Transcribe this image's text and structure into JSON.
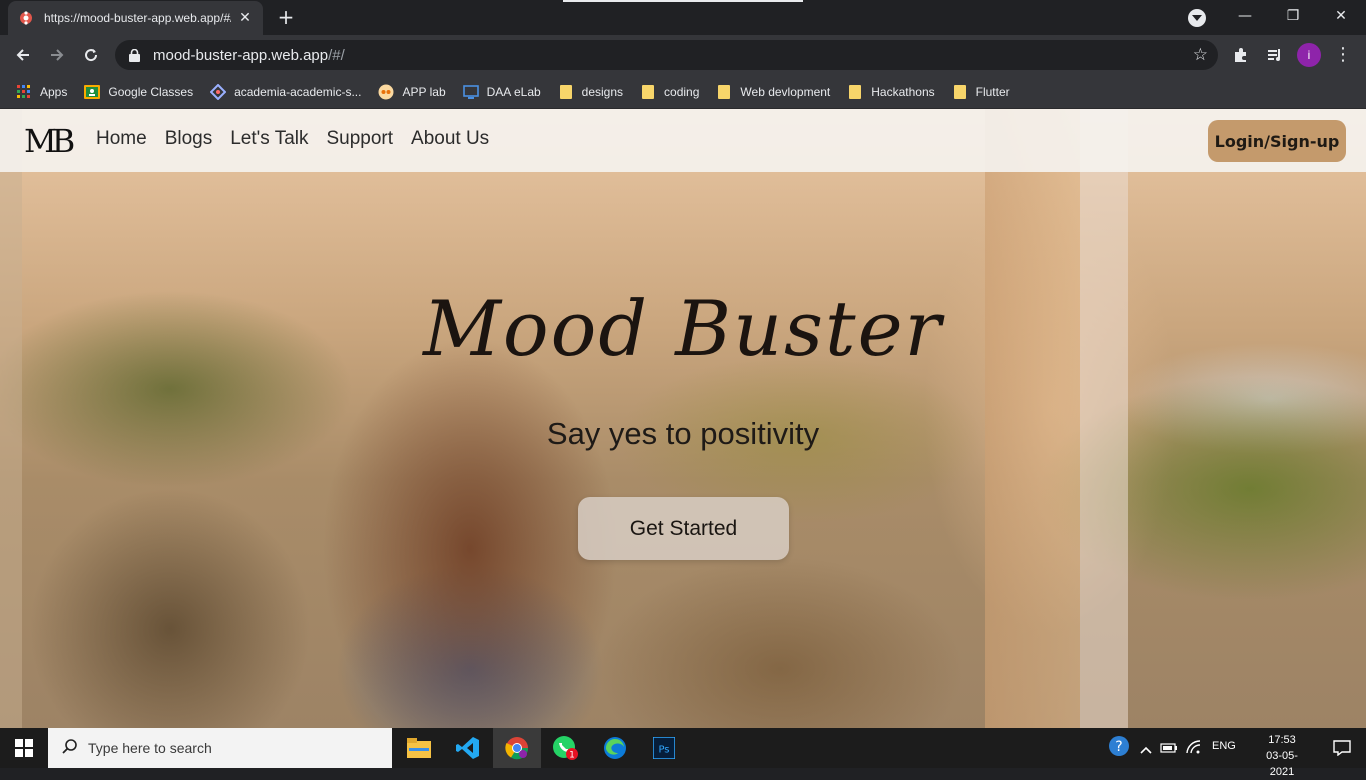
{
  "browser": {
    "tab": {
      "title": "https://mood-buster-app.web.app/#/",
      "favicon": "app-favicon-icon"
    },
    "url_host": "mood-buster-app.web.app",
    "url_path": "/#/",
    "profile_initial": "i",
    "profile_color": "#8e24aa",
    "bookmarks": [
      {
        "label": "Apps",
        "icon": "apps-grid-icon"
      },
      {
        "label": "Google Classes",
        "icon": "classroom-icon"
      },
      {
        "label": "academia-academic-s...",
        "icon": "academia-icon"
      },
      {
        "label": "APP lab",
        "icon": "app-lab-icon"
      },
      {
        "label": "DAA eLab",
        "icon": "elab-icon"
      },
      {
        "label": "designs",
        "icon": "folder-icon"
      },
      {
        "label": "coding",
        "icon": "folder-icon"
      },
      {
        "label": "Web devlopment",
        "icon": "folder-icon"
      },
      {
        "label": "Hackathons",
        "icon": "folder-icon"
      },
      {
        "label": "Flutter",
        "icon": "folder-icon"
      }
    ]
  },
  "site": {
    "logo": "MB",
    "nav": [
      "Home",
      "Blogs",
      "Let's Talk",
      "Support",
      "About Us"
    ],
    "login_label": "Login/Sign-up",
    "accent": "#c49a6c",
    "hero_title": "Mood Buster",
    "hero_subtitle": "Say yes to positivity",
    "cta_label": "Get Started"
  },
  "taskbar": {
    "search_placeholder": "Type here to search",
    "language": "ENG",
    "time": "17:53",
    "date": "03-05-2021",
    "whatsapp_badge": "1"
  }
}
